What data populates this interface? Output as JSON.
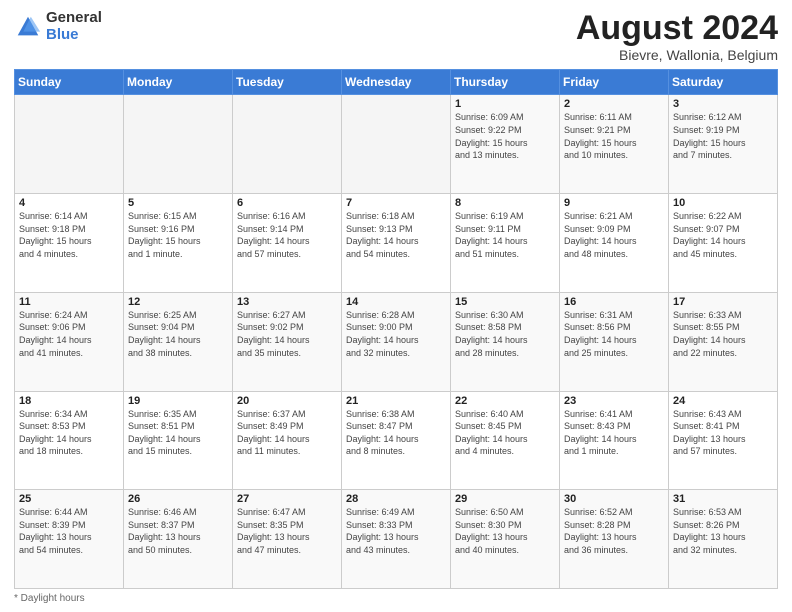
{
  "logo": {
    "general": "General",
    "blue": "Blue"
  },
  "header": {
    "month": "August 2024",
    "location": "Bievre, Wallonia, Belgium"
  },
  "days": [
    "Sunday",
    "Monday",
    "Tuesday",
    "Wednesday",
    "Thursday",
    "Friday",
    "Saturday"
  ],
  "weeks": [
    [
      {
        "day": "",
        "info": ""
      },
      {
        "day": "",
        "info": ""
      },
      {
        "day": "",
        "info": ""
      },
      {
        "day": "",
        "info": ""
      },
      {
        "day": "1",
        "info": "Sunrise: 6:09 AM\nSunset: 9:22 PM\nDaylight: 15 hours\nand 13 minutes."
      },
      {
        "day": "2",
        "info": "Sunrise: 6:11 AM\nSunset: 9:21 PM\nDaylight: 15 hours\nand 10 minutes."
      },
      {
        "day": "3",
        "info": "Sunrise: 6:12 AM\nSunset: 9:19 PM\nDaylight: 15 hours\nand 7 minutes."
      }
    ],
    [
      {
        "day": "4",
        "info": "Sunrise: 6:14 AM\nSunset: 9:18 PM\nDaylight: 15 hours\nand 4 minutes."
      },
      {
        "day": "5",
        "info": "Sunrise: 6:15 AM\nSunset: 9:16 PM\nDaylight: 15 hours\nand 1 minute."
      },
      {
        "day": "6",
        "info": "Sunrise: 6:16 AM\nSunset: 9:14 PM\nDaylight: 14 hours\nand 57 minutes."
      },
      {
        "day": "7",
        "info": "Sunrise: 6:18 AM\nSunset: 9:13 PM\nDaylight: 14 hours\nand 54 minutes."
      },
      {
        "day": "8",
        "info": "Sunrise: 6:19 AM\nSunset: 9:11 PM\nDaylight: 14 hours\nand 51 minutes."
      },
      {
        "day": "9",
        "info": "Sunrise: 6:21 AM\nSunset: 9:09 PM\nDaylight: 14 hours\nand 48 minutes."
      },
      {
        "day": "10",
        "info": "Sunrise: 6:22 AM\nSunset: 9:07 PM\nDaylight: 14 hours\nand 45 minutes."
      }
    ],
    [
      {
        "day": "11",
        "info": "Sunrise: 6:24 AM\nSunset: 9:06 PM\nDaylight: 14 hours\nand 41 minutes."
      },
      {
        "day": "12",
        "info": "Sunrise: 6:25 AM\nSunset: 9:04 PM\nDaylight: 14 hours\nand 38 minutes."
      },
      {
        "day": "13",
        "info": "Sunrise: 6:27 AM\nSunset: 9:02 PM\nDaylight: 14 hours\nand 35 minutes."
      },
      {
        "day": "14",
        "info": "Sunrise: 6:28 AM\nSunset: 9:00 PM\nDaylight: 14 hours\nand 32 minutes."
      },
      {
        "day": "15",
        "info": "Sunrise: 6:30 AM\nSunset: 8:58 PM\nDaylight: 14 hours\nand 28 minutes."
      },
      {
        "day": "16",
        "info": "Sunrise: 6:31 AM\nSunset: 8:56 PM\nDaylight: 14 hours\nand 25 minutes."
      },
      {
        "day": "17",
        "info": "Sunrise: 6:33 AM\nSunset: 8:55 PM\nDaylight: 14 hours\nand 22 minutes."
      }
    ],
    [
      {
        "day": "18",
        "info": "Sunrise: 6:34 AM\nSunset: 8:53 PM\nDaylight: 14 hours\nand 18 minutes."
      },
      {
        "day": "19",
        "info": "Sunrise: 6:35 AM\nSunset: 8:51 PM\nDaylight: 14 hours\nand 15 minutes."
      },
      {
        "day": "20",
        "info": "Sunrise: 6:37 AM\nSunset: 8:49 PM\nDaylight: 14 hours\nand 11 minutes."
      },
      {
        "day": "21",
        "info": "Sunrise: 6:38 AM\nSunset: 8:47 PM\nDaylight: 14 hours\nand 8 minutes."
      },
      {
        "day": "22",
        "info": "Sunrise: 6:40 AM\nSunset: 8:45 PM\nDaylight: 14 hours\nand 4 minutes."
      },
      {
        "day": "23",
        "info": "Sunrise: 6:41 AM\nSunset: 8:43 PM\nDaylight: 14 hours\nand 1 minute."
      },
      {
        "day": "24",
        "info": "Sunrise: 6:43 AM\nSunset: 8:41 PM\nDaylight: 13 hours\nand 57 minutes."
      }
    ],
    [
      {
        "day": "25",
        "info": "Sunrise: 6:44 AM\nSunset: 8:39 PM\nDaylight: 13 hours\nand 54 minutes."
      },
      {
        "day": "26",
        "info": "Sunrise: 6:46 AM\nSunset: 8:37 PM\nDaylight: 13 hours\nand 50 minutes."
      },
      {
        "day": "27",
        "info": "Sunrise: 6:47 AM\nSunset: 8:35 PM\nDaylight: 13 hours\nand 47 minutes."
      },
      {
        "day": "28",
        "info": "Sunrise: 6:49 AM\nSunset: 8:33 PM\nDaylight: 13 hours\nand 43 minutes."
      },
      {
        "day": "29",
        "info": "Sunrise: 6:50 AM\nSunset: 8:30 PM\nDaylight: 13 hours\nand 40 minutes."
      },
      {
        "day": "30",
        "info": "Sunrise: 6:52 AM\nSunset: 8:28 PM\nDaylight: 13 hours\nand 36 minutes."
      },
      {
        "day": "31",
        "info": "Sunrise: 6:53 AM\nSunset: 8:26 PM\nDaylight: 13 hours\nand 32 minutes."
      }
    ]
  ],
  "footer": {
    "note": "Daylight hours"
  }
}
